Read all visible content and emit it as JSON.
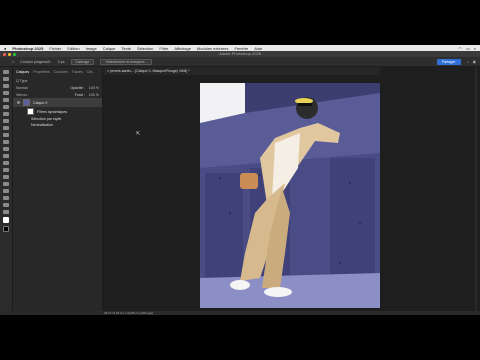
{
  "menubar": {
    "app": "Photoshop 2025",
    "items": [
      "Fichier",
      "Edition",
      "Image",
      "Calque",
      "Texte",
      "Sélection",
      "Filtre",
      "Affichage",
      "Modules externes",
      "Fenêtre",
      "Aide"
    ]
  },
  "window": {
    "title": "Adobe Photoshop 2025"
  },
  "options": {
    "feather_label": "Contour progressif :",
    "feather_value": "0 px",
    "btn1": "Cadrage",
    "btn2": "Sélectionner et masquer...",
    "share": "Partager"
  },
  "document": {
    "tab": "pexels-sarah-...(Calque 0, Masque/Rouge) 16/8) *"
  },
  "layers_panel": {
    "tabs": [
      "Calques",
      "Propriétés",
      "Couches",
      "Tracés",
      "Cal..."
    ],
    "kind_label": "Q Type",
    "blend_mode": "Normal",
    "opacity_label": "Opacité :",
    "opacity_value": "100 %",
    "lock_label": "Verrou :",
    "fill_label": "Fond :",
    "fill_value": "100 %",
    "layers": [
      {
        "name": "Calque 0"
      },
      {
        "name": "Filtres dynamiques"
      },
      {
        "name": "Sélection par stylet"
      },
      {
        "name": "Neutralisation"
      }
    ]
  },
  "status": {
    "zoom_info": "34,17 %   19 cm x 32,89 cm (300 ppp)"
  },
  "colors": {
    "accent": "#2f6fd8",
    "photo_bg": "#5d5f9e"
  }
}
